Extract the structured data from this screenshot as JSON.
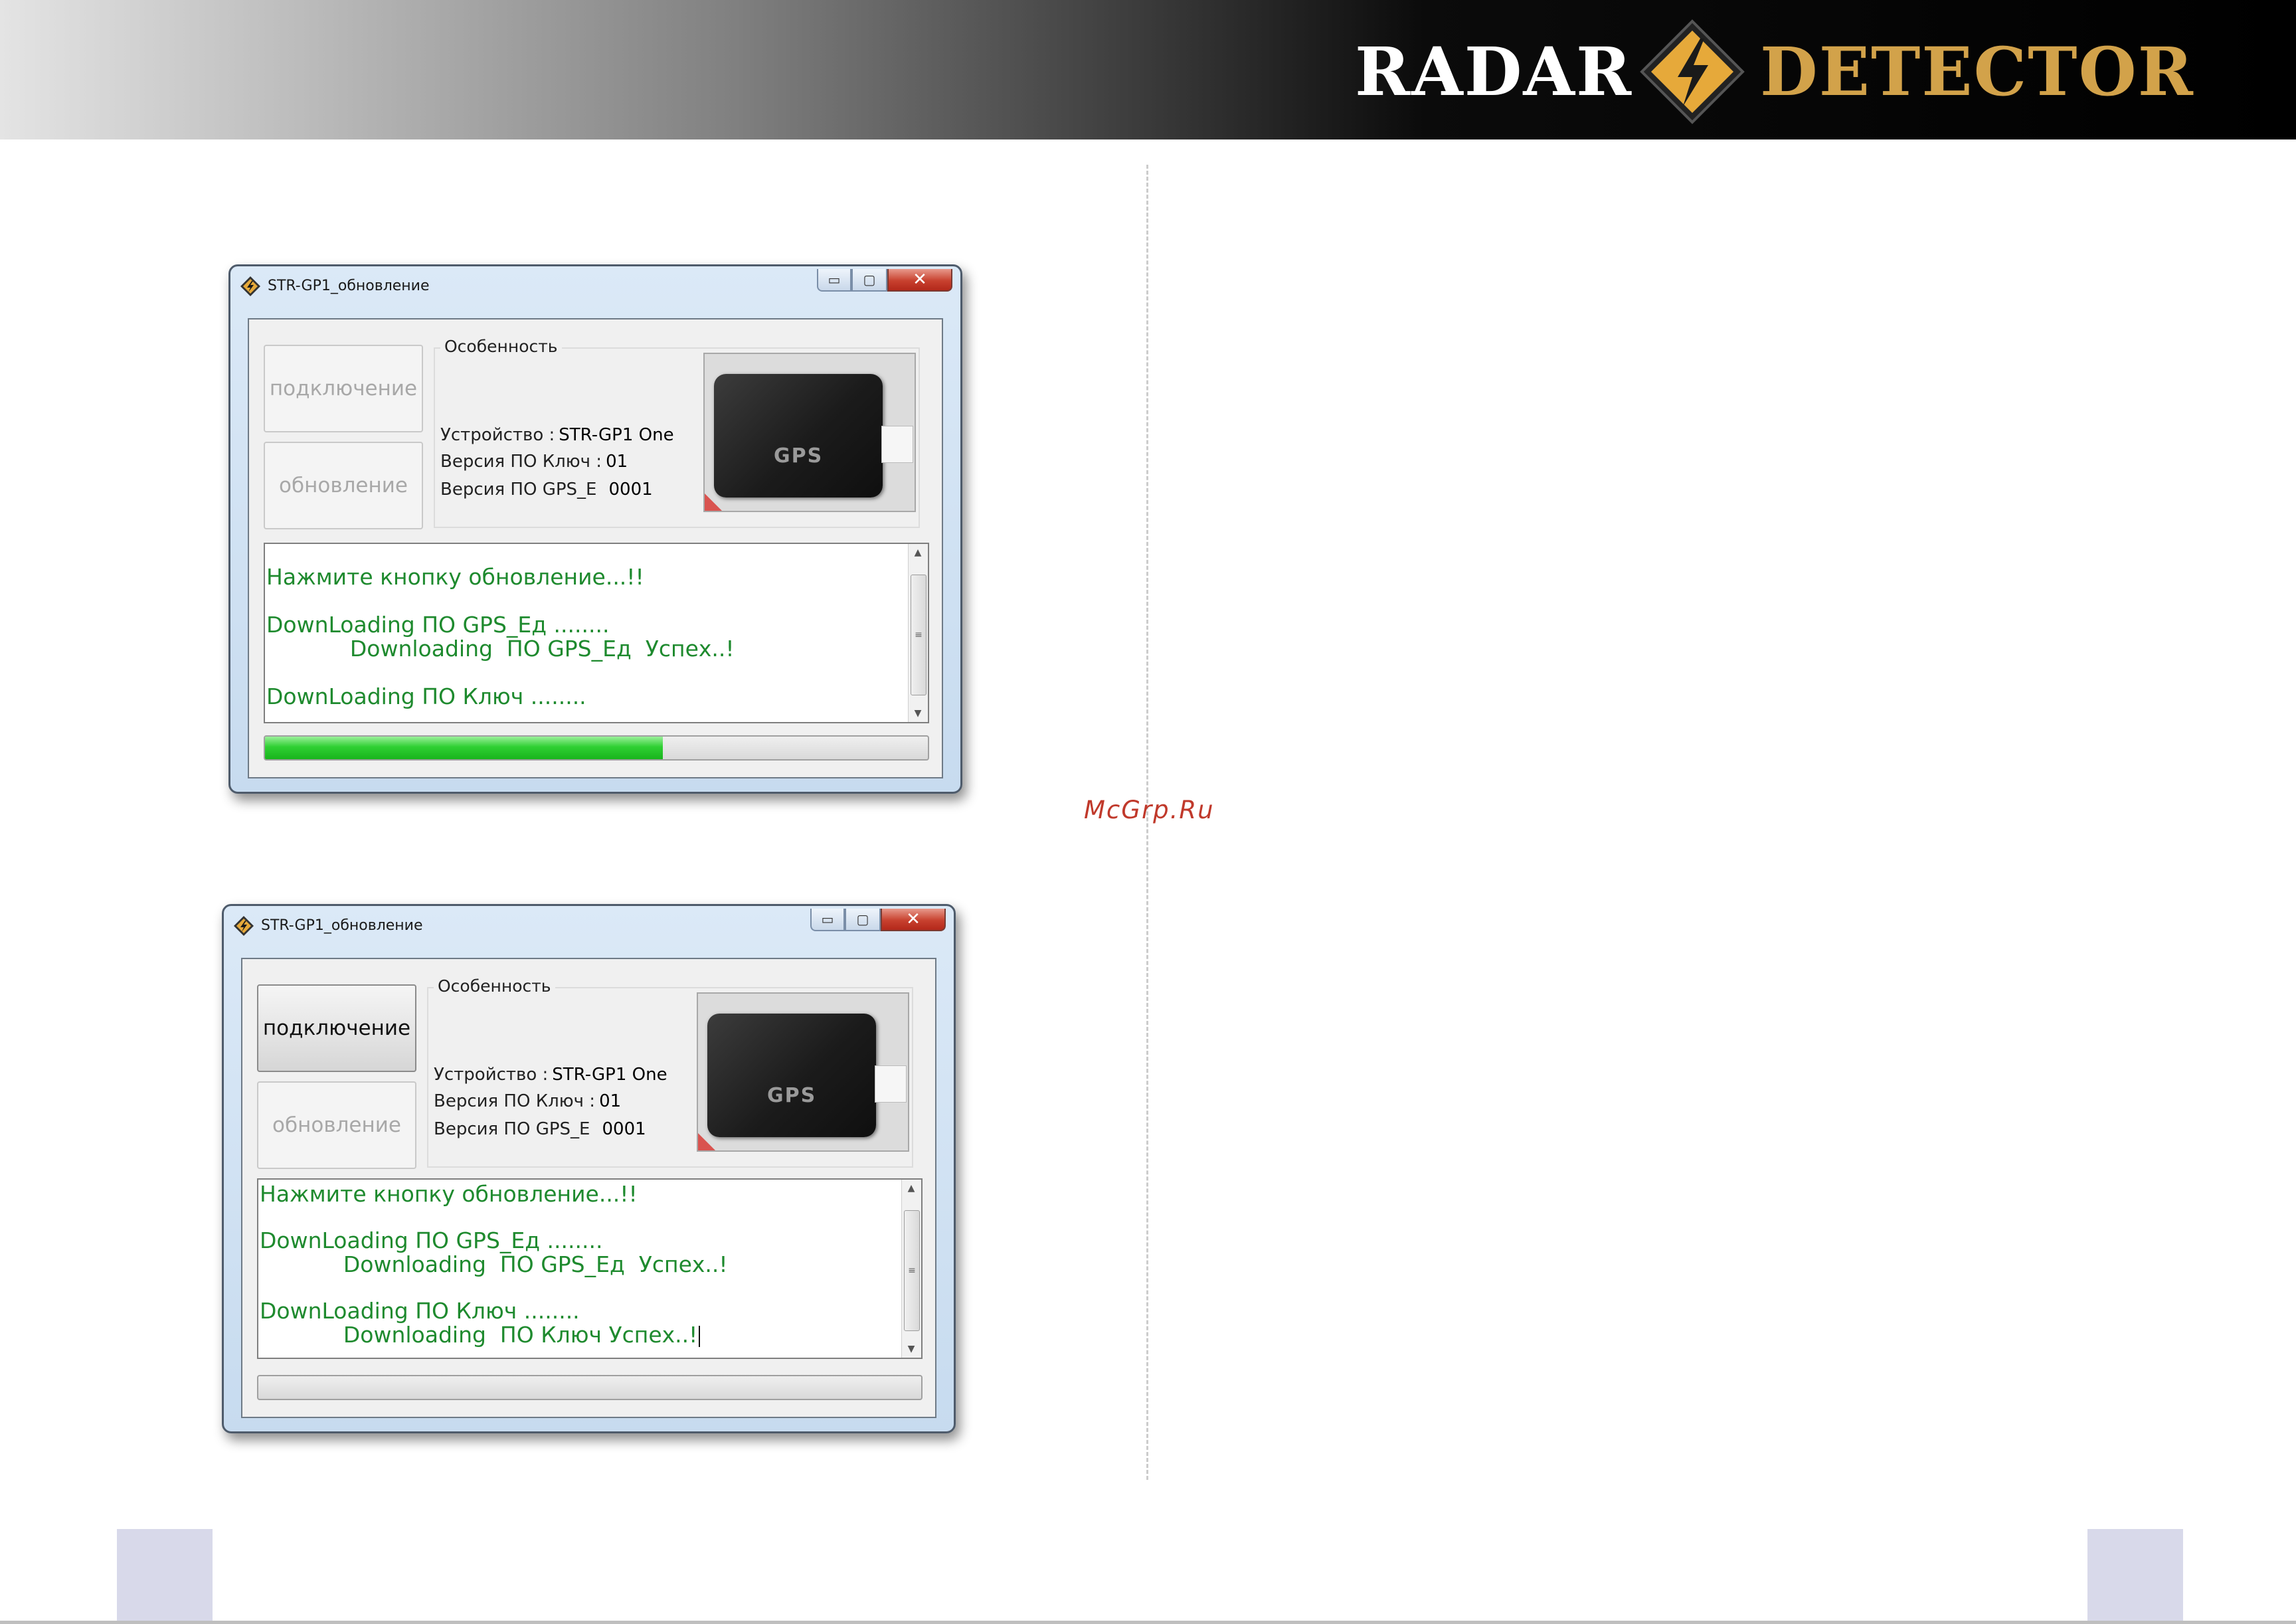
{
  "header": {
    "logo_left": "RADAR",
    "logo_right": "DETECTOR",
    "logo_colors": {
      "left": "#ffffff",
      "right": "#d2a24a",
      "diamond": "#e6a93a"
    }
  },
  "watermark": "McGrp.Ru",
  "windows": [
    {
      "title": "STR-GP1_обновление",
      "controls": {
        "minimize": "▭",
        "maximize": "▢",
        "close": "✕"
      },
      "connect_button": "подключение",
      "update_button": "обновление",
      "connect_enabled": false,
      "update_enabled": false,
      "group_label": "Особенность",
      "device_label": "Устройство :",
      "device_value": "STR-GP1 One",
      "key_version_label": "Версия ПО Ключ :",
      "key_version_value": "01",
      "gps_version_label": "Версия ПО GPS_E",
      "gps_version_value": "0001",
      "device_image_text": "GPS",
      "log_lines": [
        "Нажмите кнопку обновление...!!",
        "",
        "DownLoading ПО GPS_Ед ........",
        "            Downloading  ПО GPS_Ед  Успех..!",
        "",
        "DownLoading ПО Ключ ........"
      ],
      "progress": 0.6
    },
    {
      "title": "STR-GP1_обновление",
      "controls": {
        "minimize": "▭",
        "maximize": "▢",
        "close": "✕"
      },
      "connect_button": "подключение",
      "update_button": "обновление",
      "connect_enabled": true,
      "update_enabled": false,
      "group_label": "Особенность",
      "device_label": "Устройство :",
      "device_value": "STR-GP1 One",
      "key_version_label": "Версия ПО Ключ :",
      "key_version_value": "01",
      "gps_version_label": "Версия ПО GPS_E",
      "gps_version_value": "0001",
      "device_image_text": "GPS",
      "log_lines": [
        "Нажмите кнопку обновление...!!",
        "",
        "DownLoading ПО GPS_Ед ........",
        "            Downloading  ПО GPS_Ед  Успех..!",
        "",
        "DownLoading ПО Ключ ........",
        "            Downloading  ПО Ключ Успех..!"
      ],
      "progress": 0
    }
  ]
}
